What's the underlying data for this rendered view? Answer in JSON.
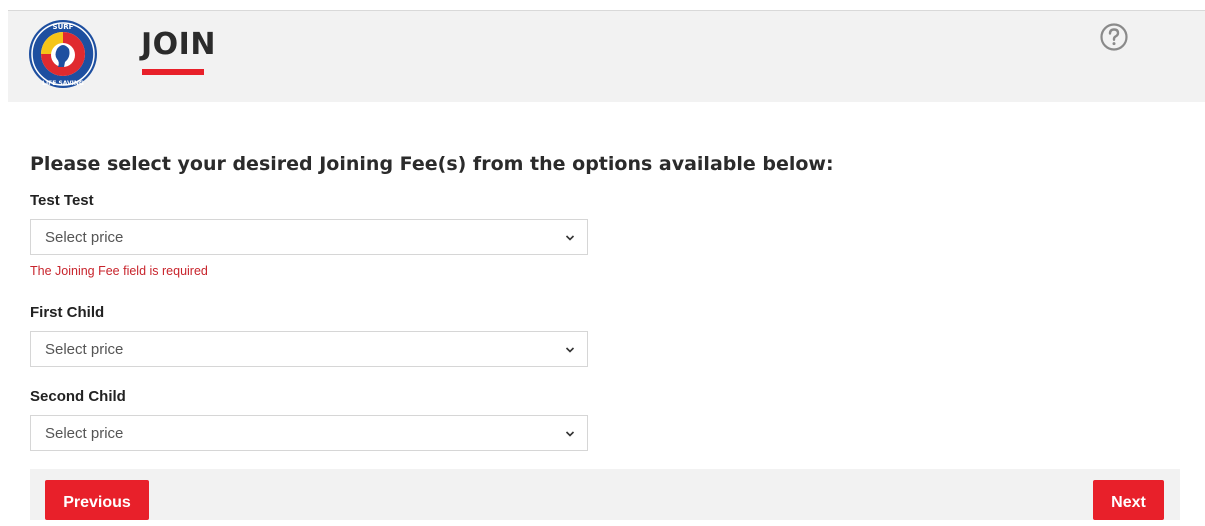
{
  "header": {
    "title": "JOIN",
    "logo_text_top": "SURF",
    "logo_text_bottom": "LIFE SAVING",
    "help_icon": "help-circle-icon"
  },
  "form": {
    "heading": "Please select your desired Joining Fee(s) from the options available below:",
    "fields": [
      {
        "label": "Test Test",
        "value": "Select price",
        "error": "The Joining Fee field is required"
      },
      {
        "label": "First Child",
        "value": "Select price"
      },
      {
        "label": "Second Child",
        "value": "Select price"
      }
    ]
  },
  "footer": {
    "previous_label": "Previous",
    "next_label": "Next"
  },
  "colors": {
    "accent": "#e8202a",
    "header_bg": "#f2f2f2",
    "error": "#c8242c",
    "logo_blue": "#1e4fa0",
    "logo_red": "#e02a2f",
    "logo_yellow": "#f5c518"
  }
}
